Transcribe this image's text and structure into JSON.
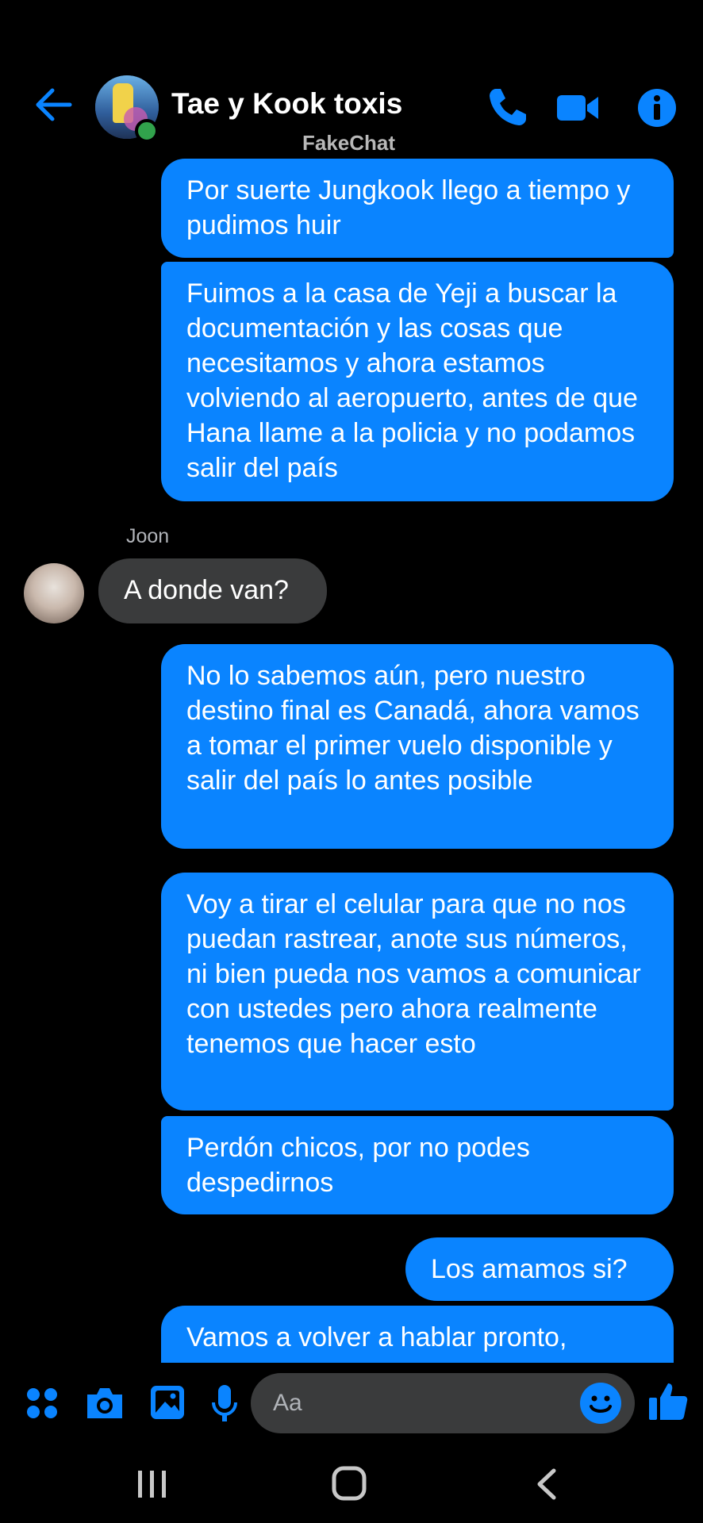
{
  "header": {
    "chat_name": "Tae y Kook toxis",
    "watermark": "FakeChat",
    "icons": [
      "back-arrow-icon",
      "phone-icon",
      "video-camera-icon",
      "info-icon"
    ],
    "accent_color": "#0a84ff"
  },
  "messages": [
    {
      "direction": "out",
      "text": "Por suerte Jungkook llego a tiempo y pudimos huir"
    },
    {
      "direction": "out",
      "text": "Fuimos a la casa de Yeji a buscar la documentación y las cosas que necesitamos y ahora estamos volviendo al aeropuerto, antes de que Hana llame a la policia y no podamos salir del país"
    },
    {
      "direction": "in",
      "sender": "Joon",
      "text": "A donde van?"
    },
    {
      "direction": "out",
      "text": "No lo sabemos aún, pero nuestro destino final es Canadá, ahora vamos a tomar el primer vuelo disponible y salir del país lo antes posible"
    },
    {
      "direction": "out",
      "text": "Voy a tirar el celular para que no nos puedan rastrear, anote sus números, ni bien pueda nos vamos a comunicar con ustedes pero ahora realmente tenemos que hacer esto"
    },
    {
      "direction": "out",
      "text": "Perdón chicos, por no podes despedirnos"
    },
    {
      "direction": "out",
      "text": "Los amamos si?"
    },
    {
      "direction": "out",
      "text": "Vamos a volver a hablar pronto,"
    }
  ],
  "composer": {
    "placeholder": "Aa",
    "icons": [
      "apps-grid-icon",
      "camera-icon",
      "gallery-icon",
      "microphone-icon",
      "emoji-icon",
      "thumbs-up-icon"
    ]
  },
  "navbar": {
    "icons": [
      "recent-apps-icon",
      "home-icon",
      "back-icon"
    ]
  }
}
